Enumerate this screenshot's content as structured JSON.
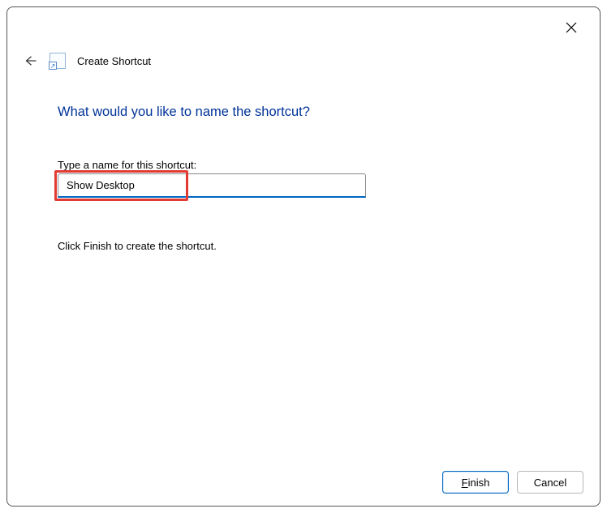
{
  "header": {
    "wizard_title": "Create Shortcut"
  },
  "main": {
    "heading": "What would you like to name the shortcut?",
    "name_label": "Type a name for this shortcut:",
    "name_value": "Show Desktop",
    "instruction": "Click Finish to create the shortcut."
  },
  "footer": {
    "finish_prefix": "F",
    "finish_rest": "inish",
    "cancel": "Cancel"
  }
}
